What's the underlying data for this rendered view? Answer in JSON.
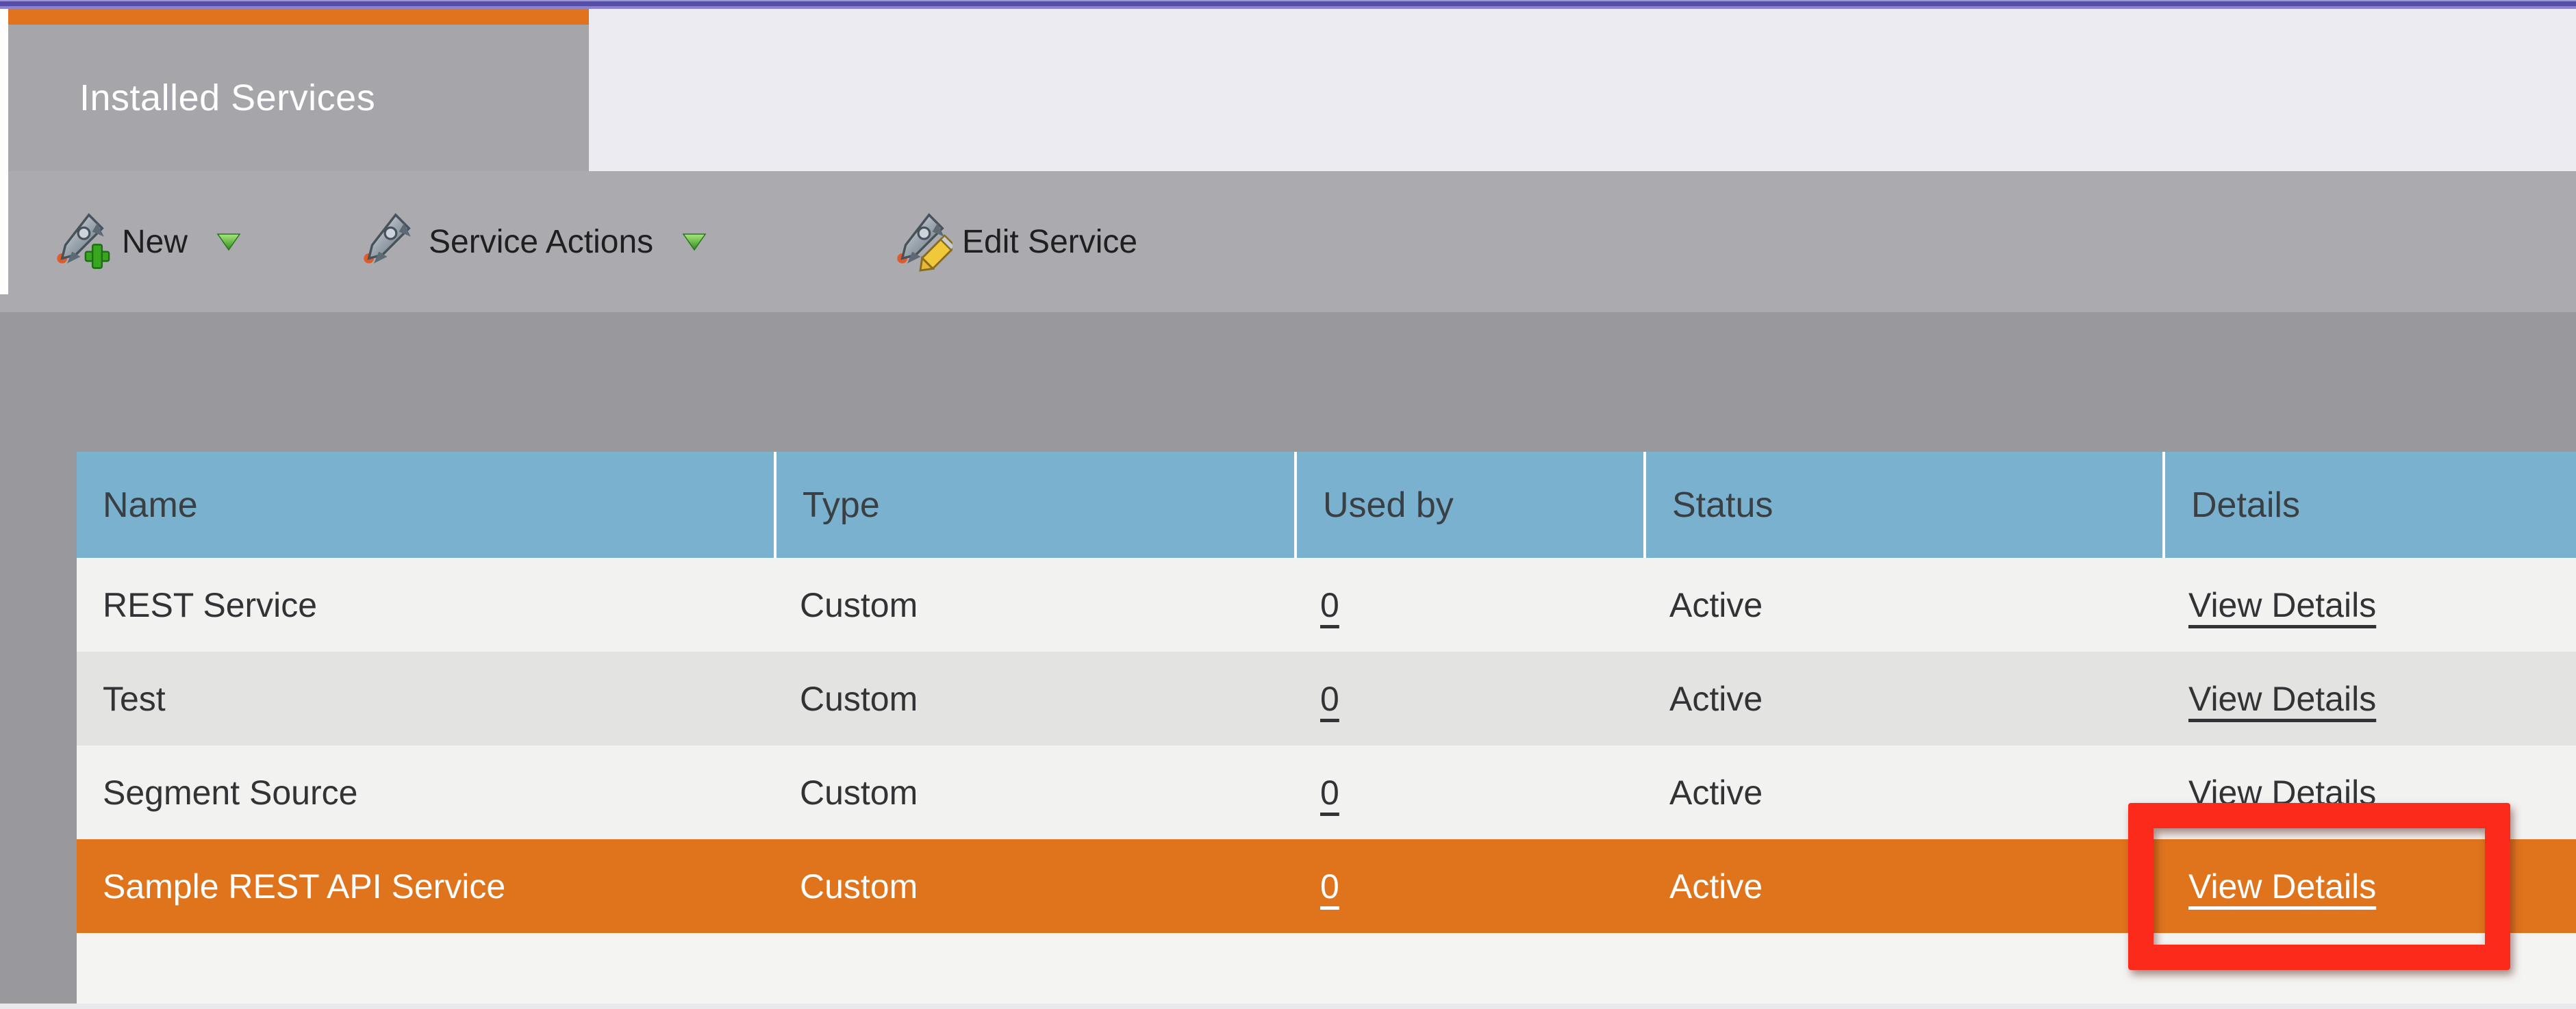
{
  "tab": {
    "title": "Installed Services"
  },
  "toolbar": {
    "items": [
      {
        "label": "New",
        "icon": "rocket-plus-icon",
        "has_dropdown": true
      },
      {
        "label": "Service Actions",
        "icon": "rocket-icon",
        "has_dropdown": true
      },
      {
        "label": "Edit Service",
        "icon": "rocket-pencil-icon",
        "has_dropdown": false
      }
    ]
  },
  "table": {
    "columns": [
      "Name",
      "Type",
      "Used by",
      "Status",
      "Details"
    ],
    "rows": [
      {
        "name": "REST Service",
        "type": "Custom",
        "used_by": "0",
        "status": "Active",
        "details_link": "View Details",
        "selected": false
      },
      {
        "name": "Test",
        "type": "Custom",
        "used_by": "0",
        "status": "Active",
        "details_link": "View Details",
        "selected": false
      },
      {
        "name": "Segment Source",
        "type": "Custom",
        "used_by": "0",
        "status": "Active",
        "details_link": "View Details",
        "selected": false
      },
      {
        "name": "Sample REST API Service",
        "type": "Custom",
        "used_by": "0",
        "status": "Active",
        "details_link": "View Details",
        "selected": true
      }
    ]
  },
  "annotation": {
    "shape": "red-rectangle-highlight"
  },
  "colors": {
    "top_bar_purple": "#564da6",
    "tab_accent_orange": "#e2731e",
    "tab_gray": "#a5a5aa",
    "toolbar_gray": "#ababaf",
    "content_gray": "#98989d",
    "header_blue": "#79b1cf",
    "row_light": "#f2f2f1",
    "row_alt": "#e3e3e2",
    "selected_row_orange": "#e0741d",
    "annotation_red": "#fb2a1b",
    "dropdown_green": "#53b23a"
  }
}
